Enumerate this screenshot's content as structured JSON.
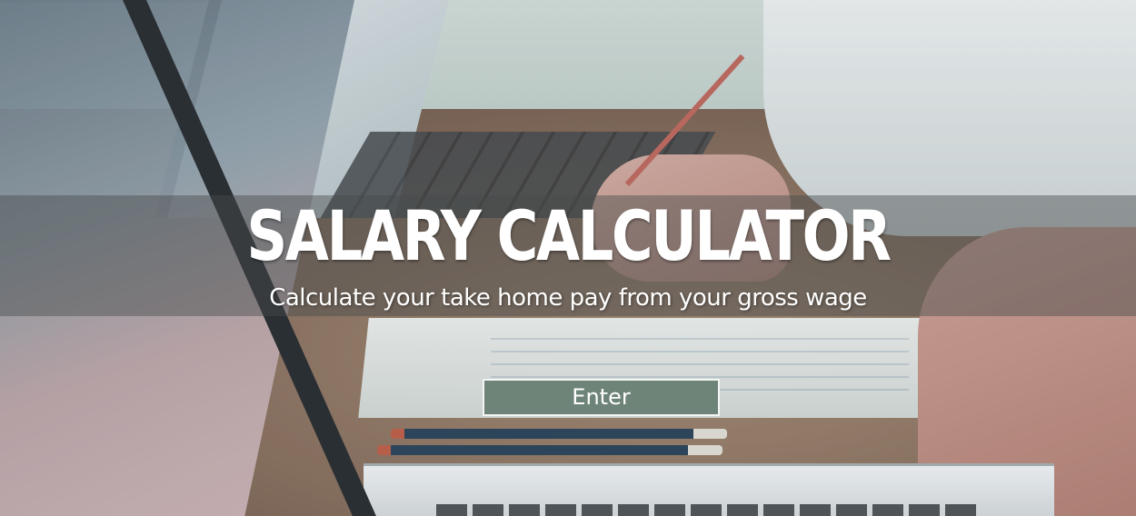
{
  "hero": {
    "title": "SALARY CALCULATOR",
    "subtitle": "Calculate your take home pay from your gross wage",
    "enter_label": "Enter"
  },
  "colors": {
    "banner_overlay": "#464b4b",
    "button_fill": "#6f8479",
    "button_border": "#f2f5f3",
    "text": "#ffffff"
  }
}
